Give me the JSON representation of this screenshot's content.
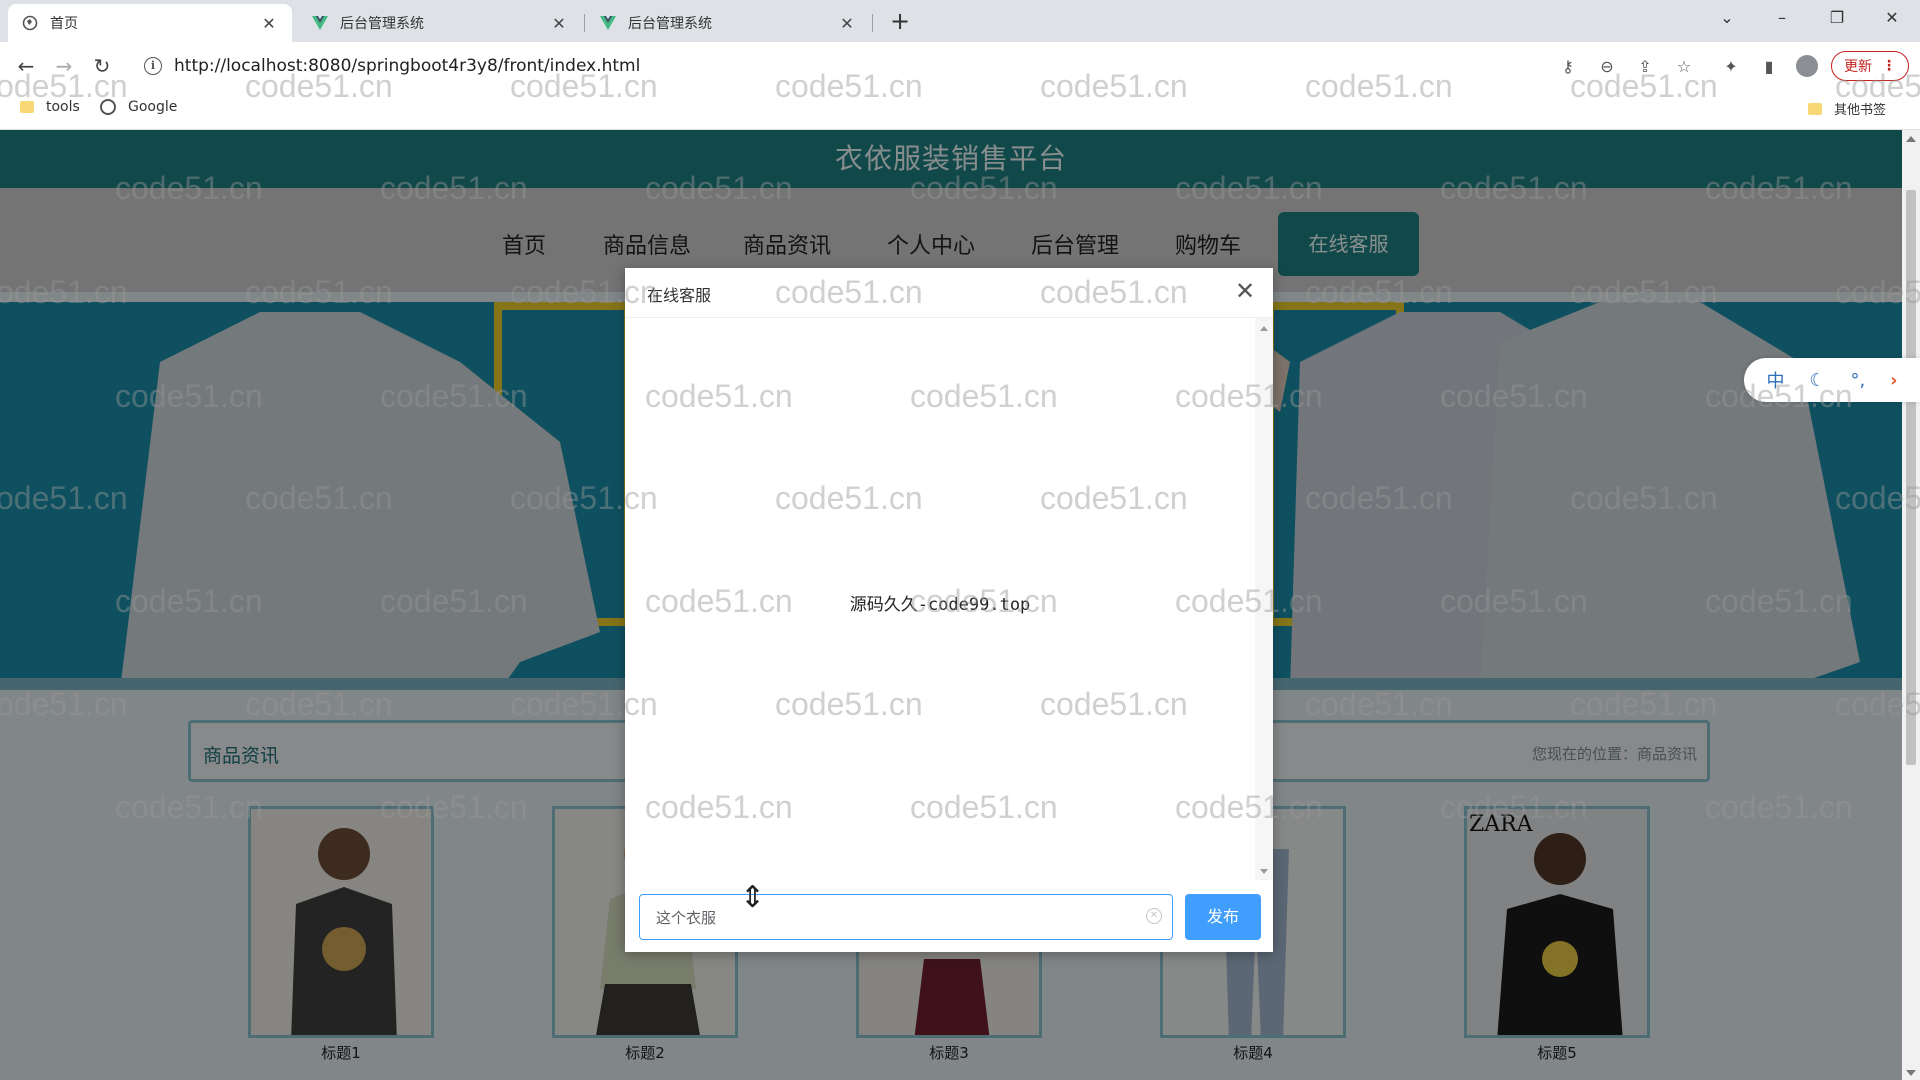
{
  "browser": {
    "tabs": [
      {
        "title": "首页",
        "active": true
      },
      {
        "title": "后台管理系统",
        "active": false
      },
      {
        "title": "后台管理系统",
        "active": false
      }
    ],
    "url": "http://localhost:8080/springboot4r3y8/front/index.html",
    "update_label": "更新",
    "bookmarks": [
      "tools",
      "Google"
    ],
    "other_bookmarks": "其他书签"
  },
  "site": {
    "title": "衣依服装销售平台",
    "nav": [
      "首页",
      "商品信息",
      "商品资讯",
      "个人中心",
      "后台管理",
      "购物车"
    ],
    "service_button": "在线客服"
  },
  "breadcrumb": {
    "title": "商品资讯",
    "location": "您现在的位置：商品资讯"
  },
  "products": [
    "标题1",
    "标题2",
    "标题3",
    "标题4",
    "标题5"
  ],
  "lang_float": {
    "lang": "中",
    "arrow": "›"
  },
  "modal": {
    "title": "在线客服",
    "message": "源码久久-code99.top",
    "input_value": "这个衣服",
    "send_label": "发布"
  },
  "watermark": "code51.cn",
  "colors": {
    "header": "#1e7c7f",
    "primary": "#409eff",
    "banner": "#1b8aa6"
  }
}
